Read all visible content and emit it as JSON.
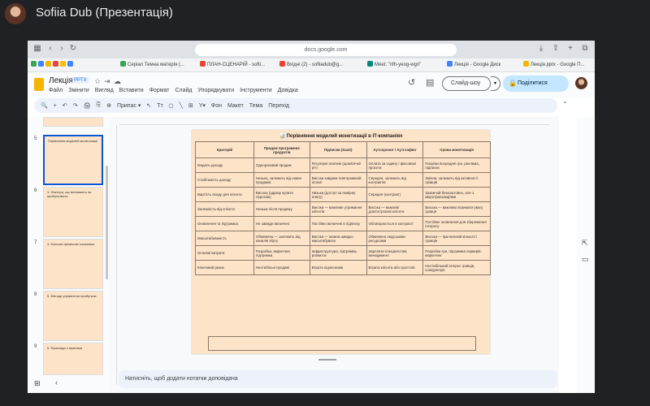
{
  "meet": {
    "presenter": "Sofiia Dub (Презентація)"
  },
  "browser": {
    "url": "docs.google.com",
    "bookmarks": [
      {
        "label": "Серіал Темна матерія (...",
        "color": "#34a853"
      },
      {
        "label": "ПЛАН-СЦЕНАРІЙ - softi...",
        "color": "#ea4335"
      },
      {
        "label": "Вхідні (2) - sofiiadub@g...",
        "color": "#ea4335"
      },
      {
        "label": "Meet: \"nfh-yeog-wgn\"",
        "color": "#00897b"
      },
      {
        "label": "Лекція - Google Диск",
        "color": "#4285f4"
      },
      {
        "label": "Лекція.pptx - Google П...",
        "color": "#f4b400"
      }
    ]
  },
  "doc": {
    "title": "Лекція",
    "badge": "PPTX",
    "menus": [
      "Файл",
      "Змінити",
      "Вигляд",
      "Вставити",
      "Формат",
      "Слайд",
      "Упорядкувати",
      "Інструменти",
      "Довідка"
    ],
    "slideshow": "Слайд-шоу",
    "share": "Поділитися"
  },
  "toolbar": {
    "items": [
      "🔍",
      "+",
      "↶",
      "↷",
      "🖨",
      "⎘",
      "⊕",
      "Припас ▾",
      "↖",
      "Tт",
      "◻",
      "╲",
      "⊞",
      "Y▾",
      "Фон",
      "Макет",
      "Тема",
      "Перехід"
    ]
  },
  "filmstrip": {
    "slides": [
      {
        "num": "5",
        "text": "Порівняння моделей монетизації",
        "selected": true
      },
      {
        "num": "6",
        "text": "3. Фактори, що впливають на прибутковість",
        "selected": false
      },
      {
        "num": "7",
        "text": "4. Ключові фінансові показники",
        "selected": false
      },
      {
        "num": "8",
        "text": "5. Методи управління прибутком",
        "selected": false
      },
      {
        "num": "9",
        "text": "6. Приклади з практики",
        "selected": false
      }
    ]
  },
  "slide": {
    "title": "📊 Порівняння моделей монетизації в IT-компаніях",
    "headers": [
      "Критерій",
      "Продаж програмних продуктів",
      "Підписки (SaaS)",
      "Аутсорсинг / Аутстафінг",
      "Ігрова монетизація"
    ],
    "rows": [
      [
        "Модель доходу",
        "Одноразовий продаж",
        "Регулярні платежі (щомісячні/річ)",
        "Оплата за годину / фіксовані проєкти",
        "Покупки всередині гри, реклама, підписки"
      ],
      [
        "Стабільність доходу",
        "Низька, залежить від нових продажів",
        "Висока завдяки повторюваній оплаті",
        "Середня, залежить від контрактів",
        "Змінна, залежить від активності гравців"
      ],
      [
        "Вартість входу для клієнта",
        "Висока (одразу купити ліцензію)",
        "Низька (доступ за помірну плату)",
        "Середня (контракт)",
        "Зазвичай безкоштовно, але з мікротранзакціями"
      ],
      [
        "Залежність від клієнта",
        "Низька після продажу",
        "Висока — важливе утримання клієнтів",
        "Висока — важливі довгострокові клієнти",
        "Висока — важливо втримати увагу гравця"
      ],
      [
        "Оновлення та підтримка",
        "Не завжди включені",
        "Постійно включені в підписку",
        "Обговорюється в контракті",
        "Постійне оновлення для збереження інтересу"
      ],
      [
        "Масштабованість",
        "Обмежена — залежить від каналів збуту",
        "Висока — можна швидко масштабувати",
        "Обмежена людськими ресурсами",
        "Висока — при великій кількості гравців"
      ],
      [
        "Основні витрати",
        "Розробка, маркетинг, підтримка",
        "Інфраструктура, підтримка, розвиток",
        "Зарплати спеціалістам, менеджмент",
        "Розробка гри, підтримка серверів, маркетинг"
      ],
      [
        "Ключовий ризик",
        "Нестабільні продажі",
        "Втрата підписників",
        "Втрата клієнта або простоїв",
        "Нестабільний інтерес гравців, конкуренція"
      ]
    ]
  },
  "notes": {
    "placeholder": "Натисніть, щоб додати нотатки доповідача"
  }
}
